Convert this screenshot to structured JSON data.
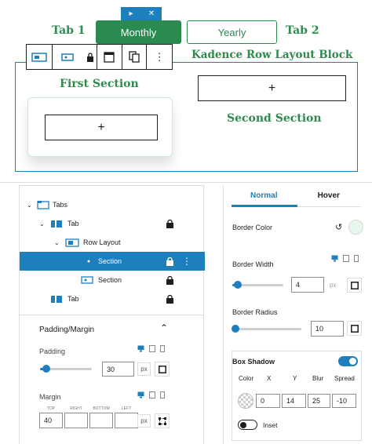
{
  "annotations": {
    "tab1": "Tab 1",
    "tab2": "Tab 2",
    "block_name": "Kadence Row Layout Block",
    "first_section": "First Section",
    "second_section": "Second Section"
  },
  "mini_toolbar": {
    "arrow": "▸",
    "close": "✕"
  },
  "tabs_block": {
    "monthly": "Monthly",
    "yearly": "Yearly"
  },
  "canvas": {
    "plus": "+"
  },
  "list_view": {
    "items": [
      {
        "label": "Tabs"
      },
      {
        "label": "Tab"
      },
      {
        "label": "Row Layout"
      },
      {
        "label": "Section"
      },
      {
        "label": "Section"
      },
      {
        "label": "Tab"
      }
    ]
  },
  "padding_margin": {
    "title": "Padding/Margin",
    "padding_label": "Padding",
    "padding_value": "30",
    "padding_slider": 0.12,
    "unit": "px",
    "margin_label": "Margin",
    "margin_sides": [
      "TOP",
      "RIGHT",
      "BOTTOM",
      "LEFT"
    ],
    "margin_values": [
      "40",
      "",
      "",
      ""
    ]
  },
  "style_panel": {
    "tab_normal": "Normal",
    "tab_hover": "Hover",
    "border_color_label": "Border Color",
    "border_color": "#e6f7ec",
    "border_width_label": "Border Width",
    "border_width_value": "4",
    "border_width_slider": 0.1,
    "border_width_unit": "px",
    "border_radius_label": "Border Radius",
    "border_radius_value": "10",
    "border_radius_slider": 0.05,
    "box_shadow_label": "Box Shadow",
    "box_shadow_on": true,
    "shadow_headers": [
      "Color",
      "X",
      "Y",
      "Blur",
      "Spread"
    ],
    "shadow_values": [
      "0",
      "14",
      "25",
      "-10"
    ],
    "inset_label": "Inset",
    "inset_on": false
  },
  "colors": {
    "accent": "#1e7fbf",
    "brand_green": "#2a8a50"
  }
}
